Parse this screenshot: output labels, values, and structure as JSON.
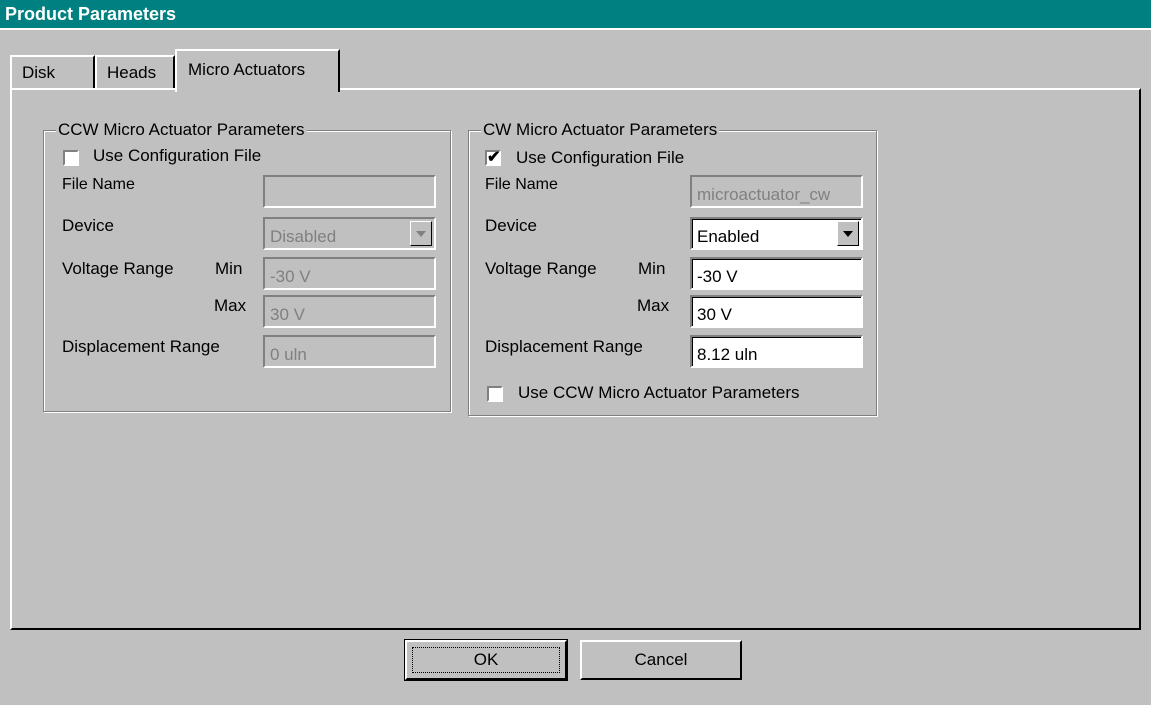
{
  "window": {
    "title": "Product Parameters"
  },
  "tabs": [
    {
      "label": "Disk"
    },
    {
      "label": "Heads"
    },
    {
      "label": "Micro Actuators"
    }
  ],
  "ccw": {
    "legend": "CCW Micro Actuator Parameters",
    "use_config_label": "Use Configuration File",
    "use_config_checked": false,
    "file_name_label": "File Name",
    "file_name_value": "",
    "device_label": "Device",
    "device_value": "Disabled",
    "voltage_label": "Voltage Range",
    "min_label": "Min",
    "min_value": "-30 V",
    "max_label": "Max",
    "max_value": "30 V",
    "displacement_label": "Displacement Range",
    "displacement_value": "0 uln",
    "enabled": false
  },
  "cw": {
    "legend": "CW Micro Actuator Parameters",
    "use_config_label": "Use Configuration File",
    "use_config_checked": true,
    "use_config_mark": "✔",
    "file_name_label": "File Name",
    "file_name_value": "microactuator_cw",
    "device_label": "Device",
    "device_value": "Enabled",
    "voltage_label": "Voltage Range",
    "min_label": "Min",
    "min_value": "-30 V",
    "max_label": "Max",
    "max_value": "30 V",
    "displacement_label": "Displacement Range",
    "displacement_value": "8.12 uln",
    "use_ccw_label": "Use CCW Micro Actuator Parameters",
    "use_ccw_checked": false,
    "enabled": true
  },
  "buttons": {
    "ok": "OK",
    "cancel": "Cancel"
  },
  "colors": {
    "titlebar": "#008080",
    "face": "#c0c0c0",
    "disabled_text": "#808080"
  }
}
